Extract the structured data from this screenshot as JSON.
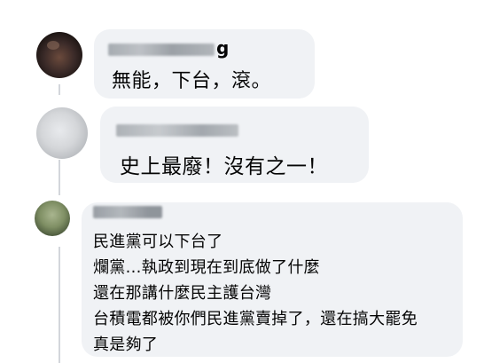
{
  "comments": [
    {
      "author_visible": "g",
      "text": "無能，下台，滾。"
    },
    {
      "author_visible": "",
      "text": "史上最廢！沒有之一！"
    },
    {
      "author_visible": "",
      "lines": [
        "民進黨可以下台了",
        "爛黨...執政到現在到底做了什麼",
        "還在那講什麼民主護台灣",
        "台積電都被你們民進黨賣掉了，還在搞大罷免",
        "真是夠了"
      ]
    }
  ],
  "colors": {
    "bubble": "#f0f2f5",
    "text": "#050505",
    "thread_line": "#d3d6db"
  }
}
